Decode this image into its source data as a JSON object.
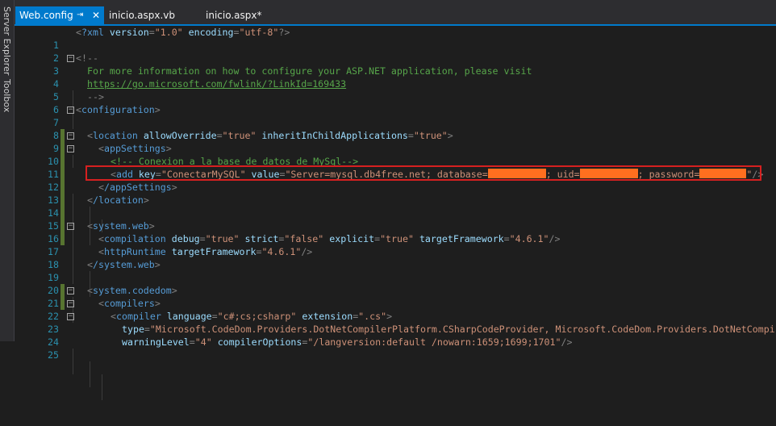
{
  "side_panels": {
    "server_explorer": "Server Explorer",
    "toolbox": "Toolbox"
  },
  "tabs": [
    {
      "label": "Web.config",
      "active": true,
      "pin_icon": "pin-icon",
      "close_icon": "close-icon"
    },
    {
      "label": "inicio.aspx.vb",
      "active": false
    },
    {
      "label": "inicio.aspx*",
      "active": false
    }
  ],
  "colors": {
    "accent": "#007acc",
    "tag": "#569cd6",
    "attribute": "#9cdcfe",
    "value": "#ce9178",
    "comment": "#57a64a",
    "line_number": "#2b91af",
    "highlight_border": "#d62020",
    "redaction": "#ff6f1f"
  },
  "lines": [
    {
      "n": "1",
      "xml_decl": "?xml",
      "a1": "version",
      "v1": "\"1.0\"",
      "a2": "encoding",
      "v2": "\"utf-8\"",
      "close": "?>"
    },
    {
      "n": "2"
    },
    {
      "n": "3",
      "open": "<!--"
    },
    {
      "n": "4",
      "text": "For more information on how to configure your ASP.NET application, please visit"
    },
    {
      "n": "5",
      "link": "https://go.microsoft.com/fwlink/?LinkId=169433"
    },
    {
      "n": "6",
      "close": "-->"
    },
    {
      "n": "7",
      "tag": "configuration"
    },
    {
      "n": "8"
    },
    {
      "n": "9",
      "tag": "location",
      "a1": "allowOverride",
      "v1": "\"true\"",
      "a2": "inheritInChildApplications",
      "v2": "\"true\""
    },
    {
      "n": "10",
      "tag": "appSettings"
    },
    {
      "n": "11",
      "comment": "<!-- Conexion a la base de datos de MySql-->"
    },
    {
      "n": "12",
      "tag": "add",
      "a1": "key",
      "v1": "\"ConectarMySQL\"",
      "a2": "value",
      "v2a": "\"Server=mysql.db4free.net; database=",
      "v2b": "; uid=",
      "v2c": "; password=",
      "v2d": "\""
    },
    {
      "n": "13",
      "tag": "/appSettings"
    },
    {
      "n": "14",
      "tag": "/location"
    },
    {
      "n": "15"
    },
    {
      "n": "16",
      "tag": "system.web"
    },
    {
      "n": "17",
      "tag": "compilation",
      "a1": "debug",
      "v1": "\"true\"",
      "a2": "strict",
      "v2": "\"false\"",
      "a3": "explicit",
      "v3": "\"true\"",
      "a4": "targetFramework",
      "v4": "\"4.6.1\""
    },
    {
      "n": "18",
      "tag": "httpRuntime",
      "a1": "targetFramework",
      "v1": "\"4.6.1\""
    },
    {
      "n": "19",
      "tag": "/system.web"
    },
    {
      "n": "20"
    },
    {
      "n": "21",
      "tag": "system.codedom"
    },
    {
      "n": "22",
      "tag": "compilers"
    },
    {
      "n": "23",
      "tag": "compiler",
      "a1": "language",
      "v1": "\"c#;cs;csharp\"",
      "a2": "extension",
      "v2": "\".cs\""
    },
    {
      "n": "24",
      "a1": "type",
      "v1": "\"Microsoft.CodeDom.Providers.DotNetCompilerPlatform.CSharpCodeProvider, Microsoft.CodeDom.Providers.DotNetCompi"
    },
    {
      "n": "25",
      "a1": "warningLevel",
      "v1": "\"4\"",
      "a2": "compilerOptions",
      "v2": "\"/langversion:default /nowarn:1659;1699;1701\""
    }
  ]
}
